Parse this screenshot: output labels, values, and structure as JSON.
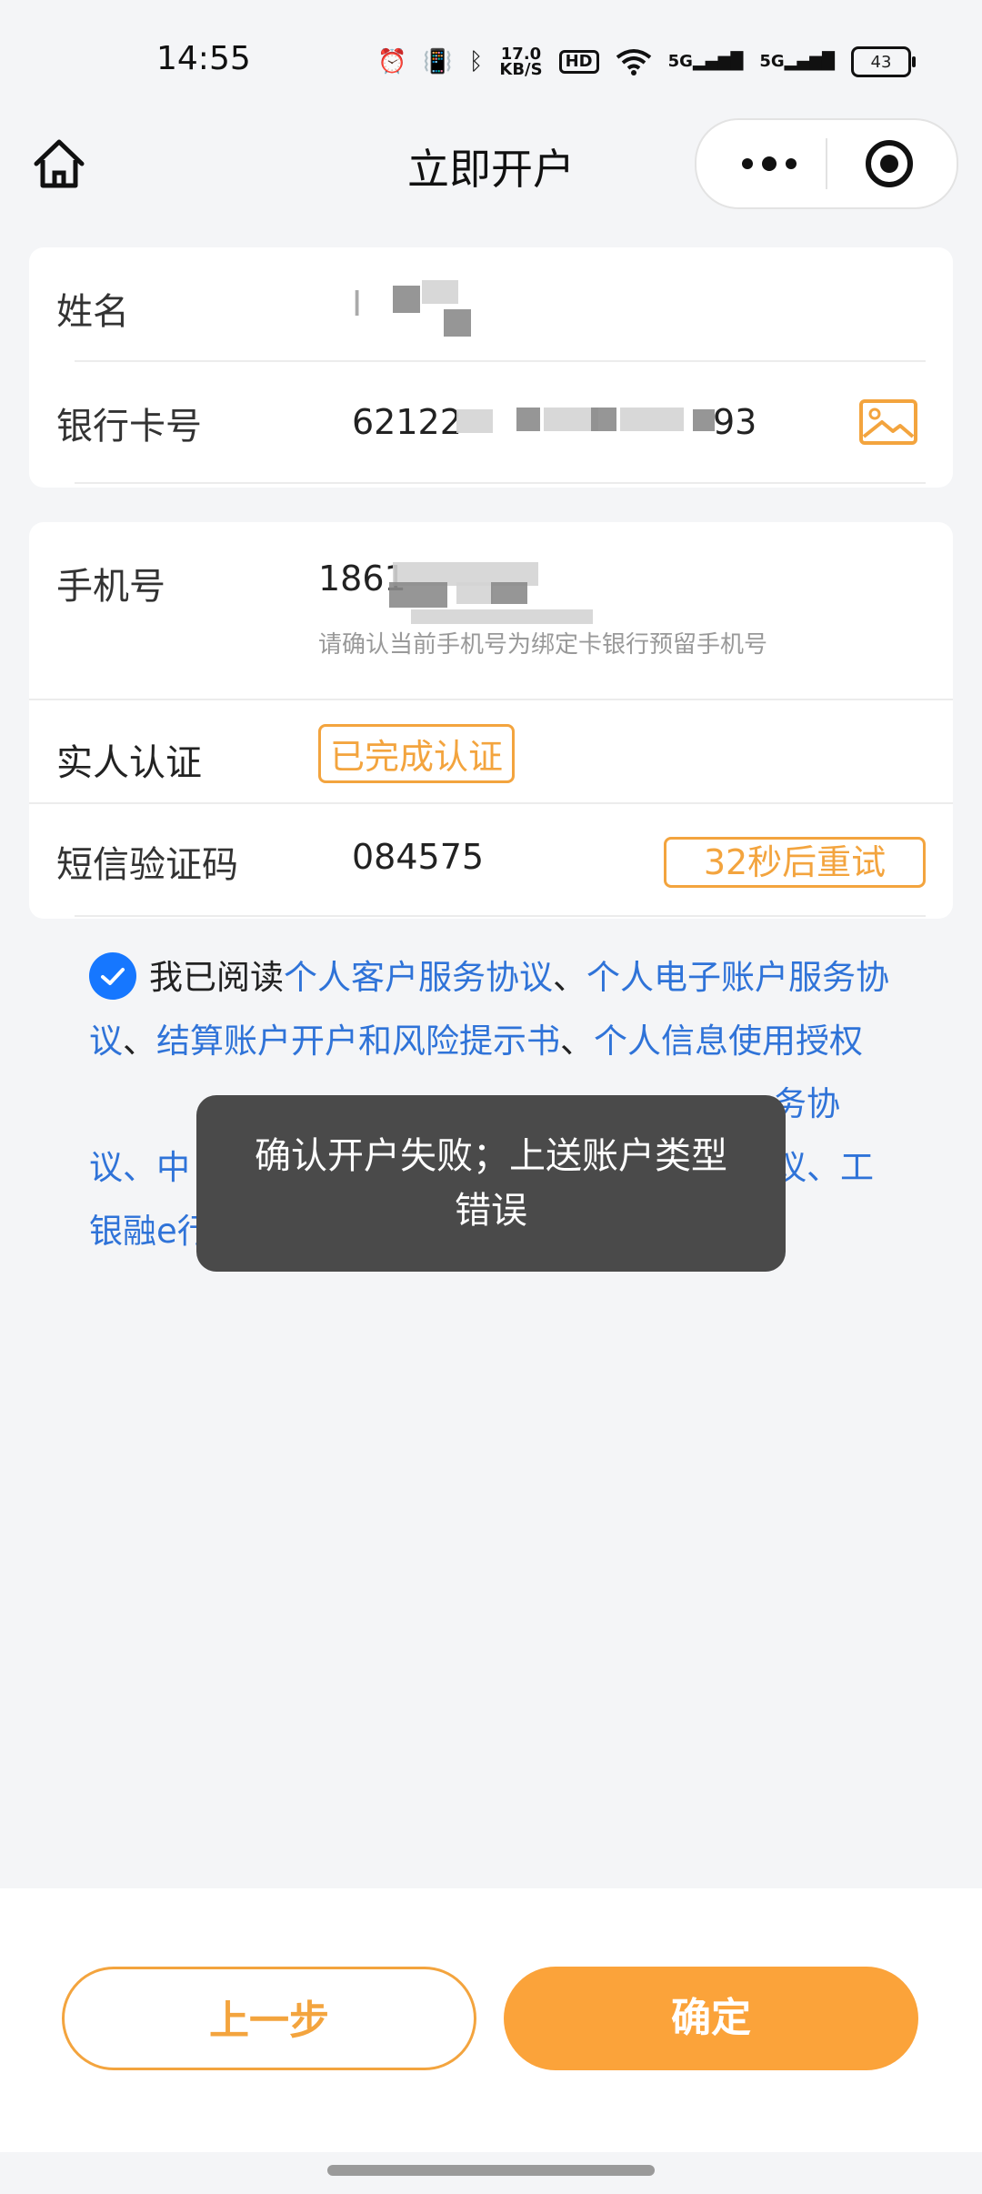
{
  "status_bar": {
    "time": "14:55",
    "net_speed_value": "17.0",
    "net_speed_unit": "KB/S",
    "hd_label": "HD",
    "sim1_label": "5G",
    "sim2_label": "5G",
    "battery": "43"
  },
  "nav": {
    "title": "立即开户"
  },
  "card1": {
    "name_label": "姓名",
    "name_value": "I",
    "card_label": "银行卡号",
    "card_value_start": "62122",
    "card_value_end": "93"
  },
  "card2": {
    "phone_label": "手机号",
    "phone_value": "1861",
    "phone_hint": "请确认当前手机号为绑定卡银行预留手机号",
    "verify_label": "实人认证",
    "verify_status": "已完成认证",
    "sms_label": "短信验证码",
    "sms_value": "084575",
    "retry_label": "32秒后重试"
  },
  "agreement": {
    "prefix": "我已阅读",
    "link1": "个人客户服务协议",
    "sep1": "、",
    "link2": "个人电子账户服务协议",
    "sep2": "、",
    "link3": "结算账户开户和风险提示书",
    "sep3": "、",
    "link4": "个人信息使用授权",
    "rest_a": "务协",
    "rest_b": "议、中",
    "rest_c": "议、工",
    "rest_d": "银融e行"
  },
  "toast": {
    "message": "确认开户失败；上送账户类型错误"
  },
  "footer": {
    "prev_label": "上一步",
    "ok_label": "确定"
  },
  "colors": {
    "accent": "#fba33a",
    "link": "#2f73d8",
    "check": "#1677ff"
  }
}
